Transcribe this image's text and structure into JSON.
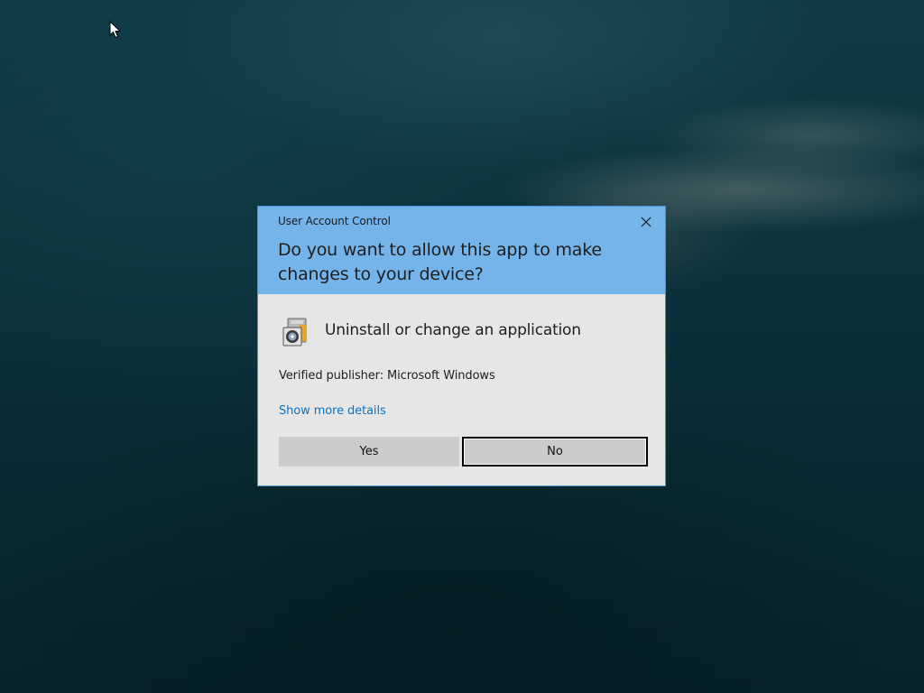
{
  "dialog": {
    "window_title": "User Account Control",
    "question": "Do you want to allow this app to make changes to your device?",
    "app_name": "Uninstall or change an application",
    "publisher": "Verified publisher: Microsoft Windows",
    "details_link": "Show more details",
    "yes_label": "Yes",
    "no_label": "No"
  },
  "icons": {
    "close": "close-icon",
    "app": "programs-icon",
    "cursor": "mouse-pointer"
  },
  "colors": {
    "header": "#75b4ea",
    "body": "#e6e6e6",
    "link": "#0a73c4",
    "button": "#cccccc",
    "border": "#4a90d8"
  }
}
